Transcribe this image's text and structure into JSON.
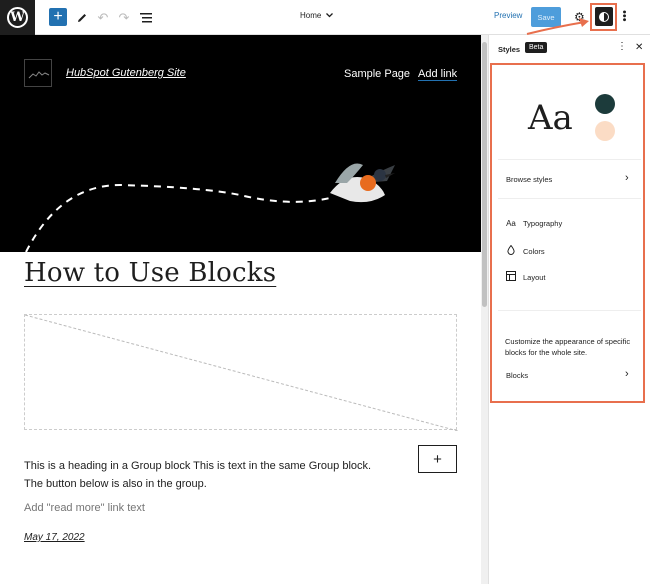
{
  "topbar": {
    "document_title": "Home",
    "preview_label": "Preview",
    "save_label": "Save"
  },
  "canvas": {
    "site_title": "HubSpot Gutenberg Site",
    "nav_items": [
      "Sample Page",
      "Add link"
    ],
    "post_title": "How to Use Blocks",
    "group_text": "This is a heading in a Group block This is text in the same Group block. The button below is also in the group.",
    "read_more_placeholder": "Add \"read more\" link text",
    "post_date": "May 17, 2022"
  },
  "sidebar": {
    "title": "Styles",
    "badge": "Beta",
    "preview_text": "Aa",
    "browse_styles": "Browse styles",
    "items": [
      {
        "label": "Typography",
        "icon": "typography-icon"
      },
      {
        "label": "Colors",
        "icon": "droplet-icon"
      },
      {
        "label": "Layout",
        "icon": "layout-icon"
      }
    ],
    "blocks_description": "Customize the appearance of specific blocks for the whole site.",
    "blocks_label": "Blocks"
  },
  "colors": {
    "accent": "#2271b1",
    "highlight": "#e86f4d",
    "palette_primary": "#1c3b3b",
    "palette_secondary": "#fbdcc5"
  }
}
